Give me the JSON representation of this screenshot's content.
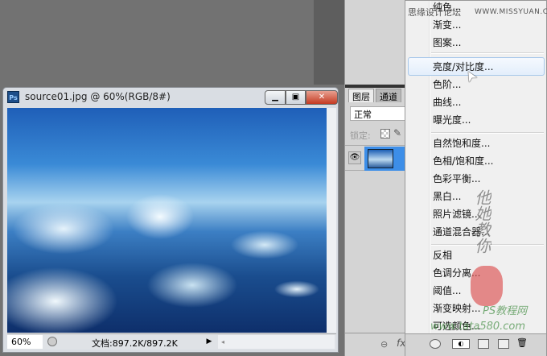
{
  "document": {
    "title": "source01.jpg @ 60%(RGB/8#)",
    "app_icon": "Ps",
    "zoom": "60%",
    "doc_size": "文档:897.2K/897.2K"
  },
  "layers_panel": {
    "tabs": [
      "图层",
      "通道"
    ],
    "blend_mode": "正常",
    "lock_label": "锁定:"
  },
  "menu": {
    "items": [
      "纯色...",
      "渐变...",
      "图案...",
      "亮度/对比度...",
      "色阶...",
      "曲线...",
      "曝光度...",
      "自然饱和度...",
      "色相/饱和度...",
      "色彩平衡...",
      "黑白...",
      "照片滤镜...",
      "通道混合器...",
      "反相",
      "色调分离...",
      "阈值...",
      "渐变映射...",
      "可选颜色..."
    ],
    "highlighted": "亮度/对比度..."
  },
  "watermarks": {
    "forum": "思缘设计论坛",
    "url": "WWW.MISSYUAN.COM",
    "sig": "他她教你",
    "site_cn": "PS教程网",
    "site": "www.tata580.com"
  }
}
